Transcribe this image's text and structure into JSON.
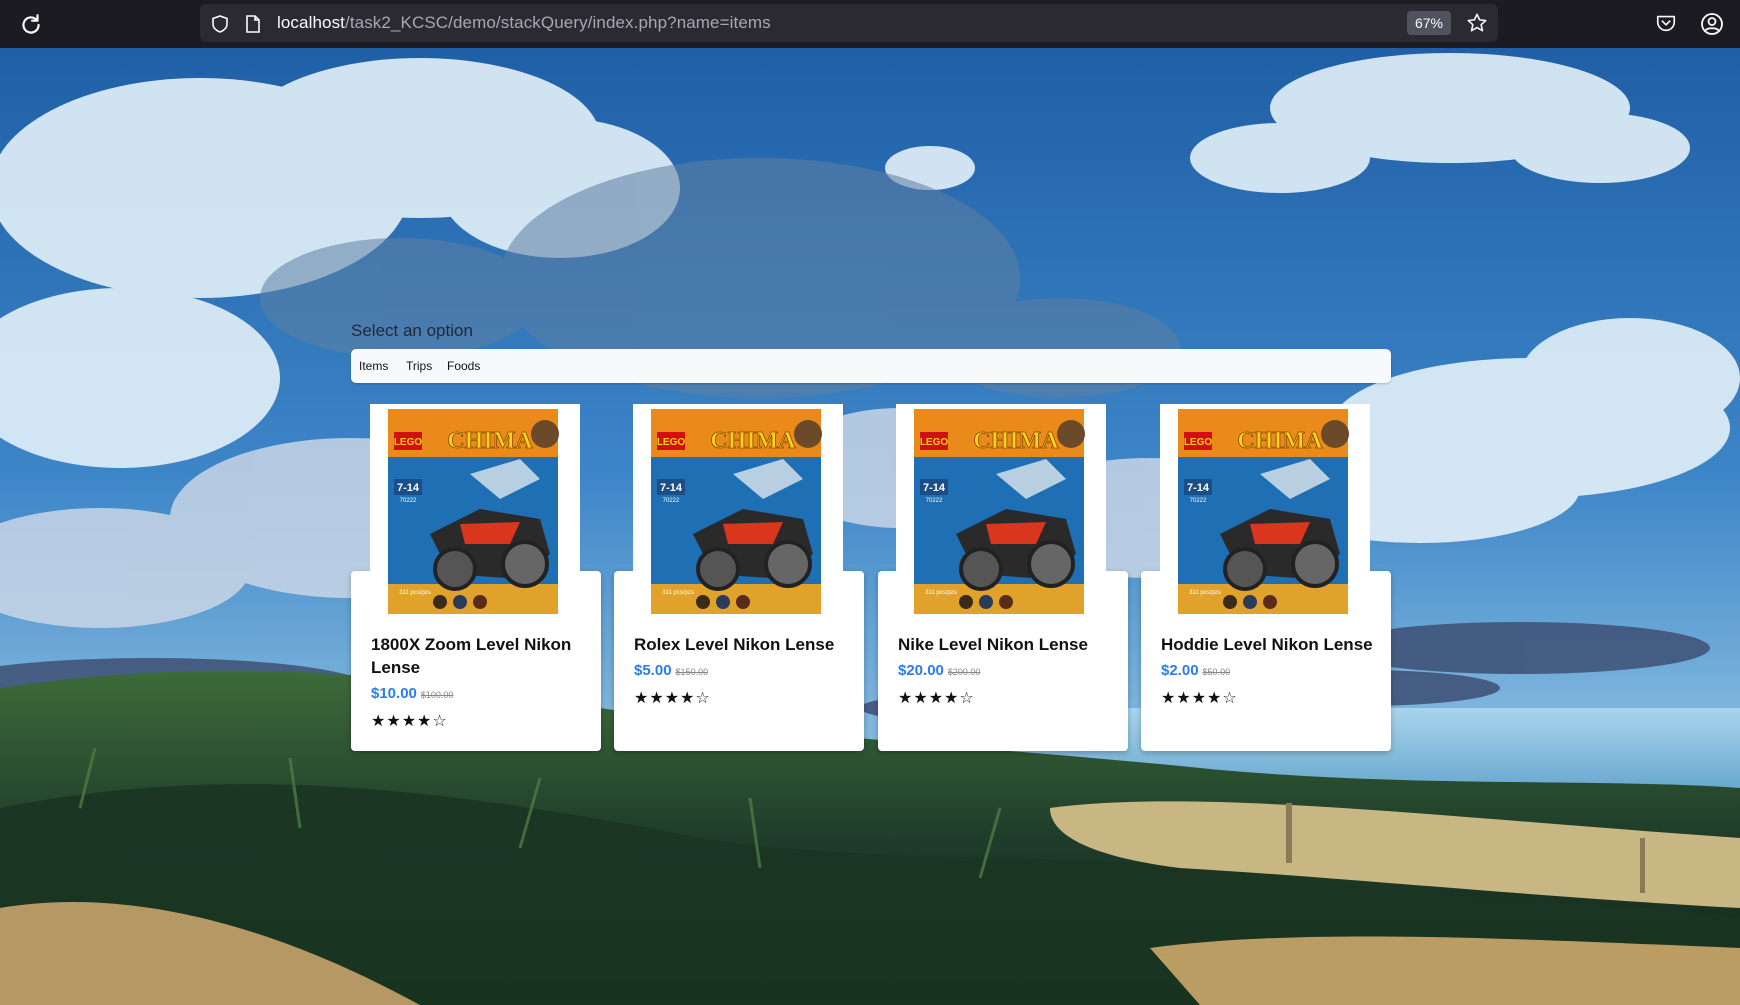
{
  "browser": {
    "url_host": "localhost",
    "url_path": "/task2_KCSC/demo/stackQuery/index.php?name=items",
    "zoom": "67%"
  },
  "page": {
    "select_label": "Select an option",
    "nav": [
      "Items",
      "Trips",
      "Foods"
    ]
  },
  "products": [
    {
      "title": "1800X Zoom Level Nikon Lense",
      "price": "$10.00",
      "old_price": "$100.00",
      "stars": "★★★★☆",
      "rating": 4
    },
    {
      "title": "Rolex Level Nikon Lense",
      "price": "$5.00",
      "old_price": "$150.00",
      "stars": "★★★★☆",
      "rating": 4
    },
    {
      "title": "Nike Level Nikon Lense",
      "price": "$20.00",
      "old_price": "$200.00",
      "stars": "★★★★☆",
      "rating": 4
    },
    {
      "title": "Hoddie Level Nikon Lense",
      "price": "$2.00",
      "old_price": "$50.00",
      "stars": "★★★★☆",
      "rating": 4
    }
  ],
  "product_image": {
    "brand": "LEGO",
    "series": "CHIMA",
    "age": "7-14",
    "set_number": "70222",
    "pieces": "311 pcs/pzs"
  },
  "colors": {
    "chrome_bg": "#1c1b22",
    "urlbar_bg": "#2b2a33",
    "price_blue": "#2b7de9"
  }
}
